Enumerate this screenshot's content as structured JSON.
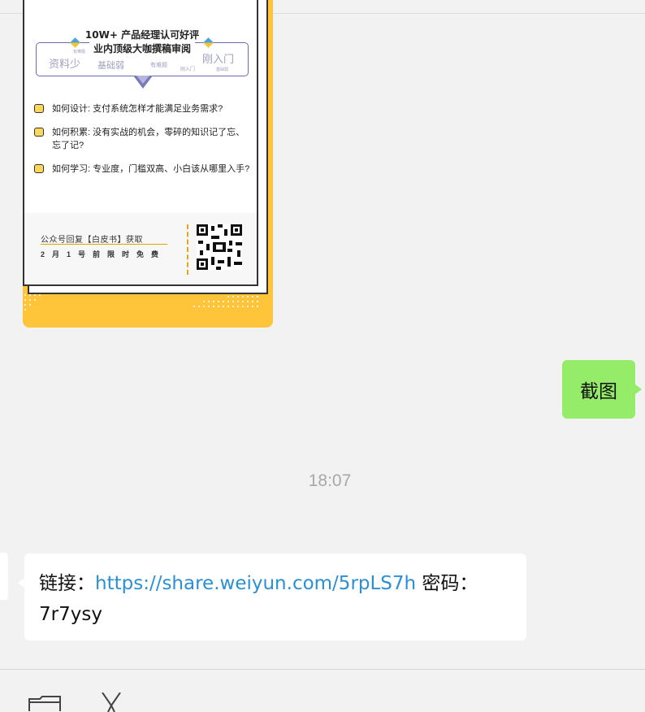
{
  "poster": {
    "title_line1": "10W+ 产品经理认可好评",
    "title_line2": "业内顶级大咖撰稿审阅",
    "tags": [
      "资料少",
      "基础弱",
      "刚入门",
      "有难题",
      "有难题",
      "刚入门",
      "基础弱"
    ],
    "questions": [
      "如何设计: 支付系统怎样才能满足业务需求?",
      "如何积累: 没有实战的机会，零碎的知识记了忘、忘了记?",
      "如何学习: 专业度，门槛双高、小白该从哪里入手?"
    ],
    "footer_line1": "公众号回复【白皮书】获取",
    "footer_line2": "2月1号前限时免费",
    "colors": {
      "background": "#fec43a",
      "accent": "#6b6bb0"
    }
  },
  "sent_message": {
    "text": "截图",
    "color": "#95ec69"
  },
  "timestamp": "18:07",
  "received_message": {
    "prefix": "链接：",
    "link": "https://share.weiyun.com/5rpLS7h",
    "suffix": " 密码：",
    "password": "7r7ysy",
    "link_color": "#2b8fd6"
  },
  "toolbar": {
    "icons": [
      "folder-icon",
      "scissors-icon"
    ]
  }
}
